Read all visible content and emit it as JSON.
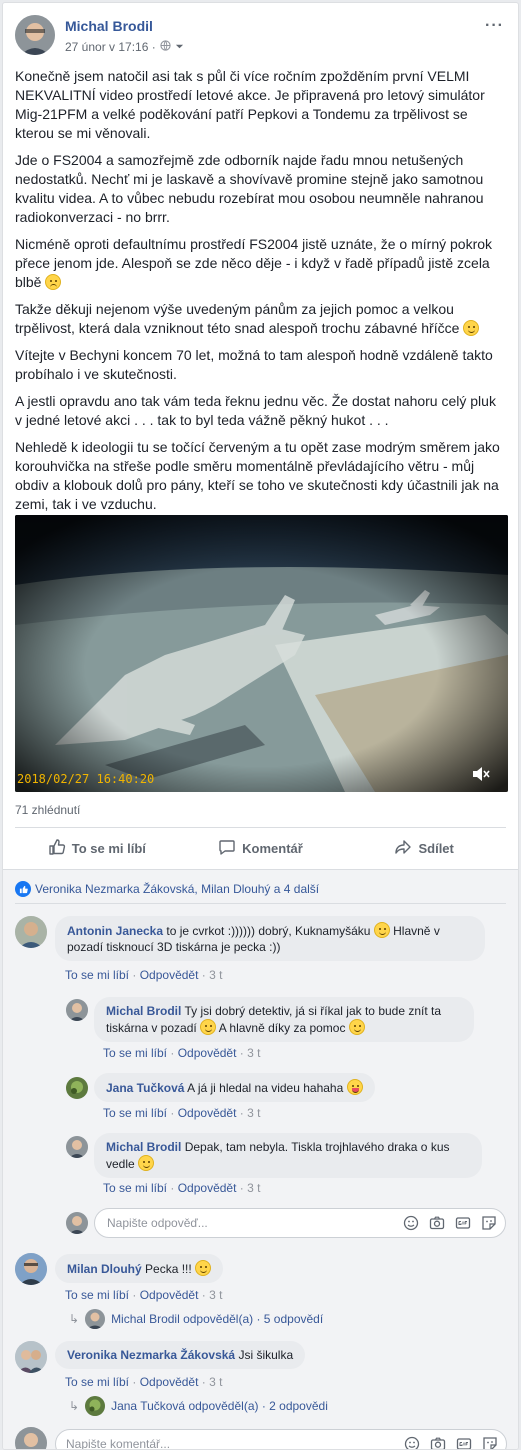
{
  "post": {
    "author": "Michal Brodil",
    "timestamp": "27 únor v 17:16 ·",
    "more": "···",
    "paragraphs": [
      "Konečně jsem natočil asi tak s půl či více ročním zpožděním první VELMI NEKVALITNÍ video prostředí letové akce. Je připravená pro letový simulátor Mig-21PFM a velké poděkování patří Pepkovi a Tondemu za trpělivost se kterou se mi věnovali.",
      "Jde o FS2004 a samozřejmě zde odborník najde řadu mnou netušených nedostatků. Nechť mi je laskavě a shovívavě promine stejně jako samotnou kvalitu videa. A to vůbec nebudu rozebírat mou osobou neumněle nahranou radiokonverzaci - no brrr.",
      "Nicméně oproti defaultnímu prostředí FS2004 jistě uznáte, že o mírný pokrok přece jenom jde. Alespoň se zde něco děje - i když v řadě případů jistě zcela blbě",
      "Takže děkuji nejenom výše uvedeným pánům za jejich pomoc a velkou trpělivost, která dala vzniknout této snad alespoň trochu zábavné hříčce",
      "Vítejte v Bechyni koncem 70 let, možná to tam alespoň hodně vzdáleně takto probíhalo i ve skutečnosti.",
      "A jestli opravdu ano tak vám teda řeknu jednu věc. Že dostat nahoru celý pluk v jedné letové akci . . . tak to byl teda vážně pěkný hukot . . .",
      "Nehledě k ideologii tu se točící červeným a tu opět zase modrým směrem jako korouhvička na střeše podle směru momentálně převládajícího větru - můj obdiv a klobouk dolů pro pány, kteří se toho ve skutečnosti kdy účastnili jak na zemi, tak i ve vzduchu."
    ],
    "video_timestamp": "2018/02/27 16:40:20",
    "views": "71 zhlédnutí"
  },
  "actions": {
    "like": "To se mi líbí",
    "comment": "Komentář",
    "share": "Sdílet"
  },
  "reactions": {
    "summary": "Veronika Nezmarka Žákovská, Milan Dlouhý a 4 další"
  },
  "links": {
    "like": "To se mi líbí",
    "reply": "Odpovědět",
    "dot": "·",
    "time": "3 t"
  },
  "comments": [
    {
      "name": "Antonin Janecka",
      "text1": "to je cvrkot :)))))) dobrý, Kuknamyšáku",
      "text2": "Hlavně v pozadí tisknoucí 3D tiskárna je pecka :))"
    },
    {
      "name": "Michal Brodil",
      "text1": "Ty jsi dobrý detektiv, já si říkal jak to bude znít ta tiskárna v pozadí",
      "text2": "A hlavně díky za pomoc"
    },
    {
      "name": "Jana Tučková",
      "text1": "A já ji hledal na videu hahaha"
    },
    {
      "name": "Michal Brodil",
      "text1": "Depak, tam nebyla. Tiskla trojhlavého draka o kus vedle"
    },
    {
      "name": "Milan Dlouhý",
      "text1": "Pecka !!!"
    },
    {
      "name": "Veronika Nezmarka Žákovská",
      "text1": "Jsi šikulka"
    }
  ],
  "reply_summaries": [
    "Michal Brodil odpověděl(a) · 5 odpovědí",
    "Jana Tučková odpověděl(a) · 2 odpovědi"
  ],
  "inputs": {
    "reply_placeholder": "Napište odpověď...",
    "comment_placeholder": "Napište komentář..."
  },
  "colors": {
    "link": "#385898",
    "author": "#365899",
    "bubble": "#e9ebee",
    "background": "#f2f3f5",
    "video_timestamp": "#f0b400"
  }
}
